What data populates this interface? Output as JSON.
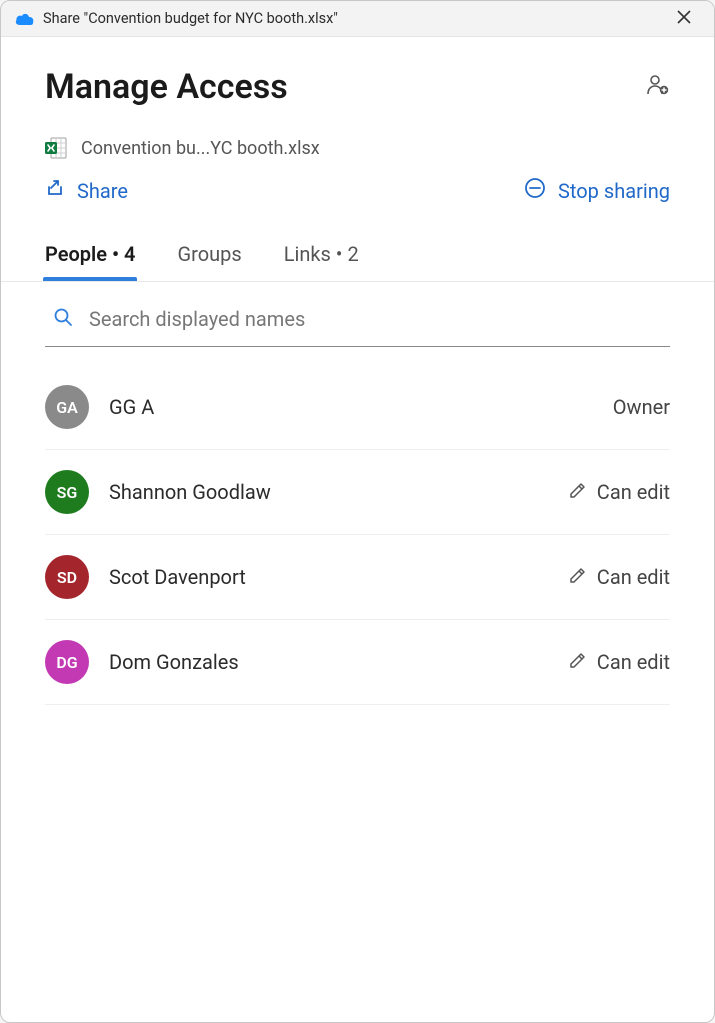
{
  "titlebar": {
    "text": "Share \"Convention budget for NYC booth.xlsx\""
  },
  "header": {
    "title": "Manage Access"
  },
  "file": {
    "name": "Convention bu...YC booth.xlsx"
  },
  "actions": {
    "share_label": "Share",
    "stop_label": "Stop sharing"
  },
  "tabs": {
    "people_label": "People",
    "people_count": "4",
    "groups_label": "Groups",
    "links_label": "Links",
    "links_count": "2"
  },
  "search": {
    "placeholder": "Search displayed names"
  },
  "people": [
    {
      "initials": "GA",
      "name": "GG A",
      "color": "#8a8a8a",
      "role": "Owner",
      "editable": false
    },
    {
      "initials": "SG",
      "name": "Shannon Goodlaw",
      "color": "#1e7b1e",
      "role": "Can edit",
      "editable": true
    },
    {
      "initials": "SD",
      "name": "Scot Davenport",
      "color": "#a4262c",
      "role": "Can edit",
      "editable": true
    },
    {
      "initials": "DG",
      "name": "Dom Gonzales",
      "color": "#c239b3",
      "role": "Can edit",
      "editable": true
    }
  ]
}
